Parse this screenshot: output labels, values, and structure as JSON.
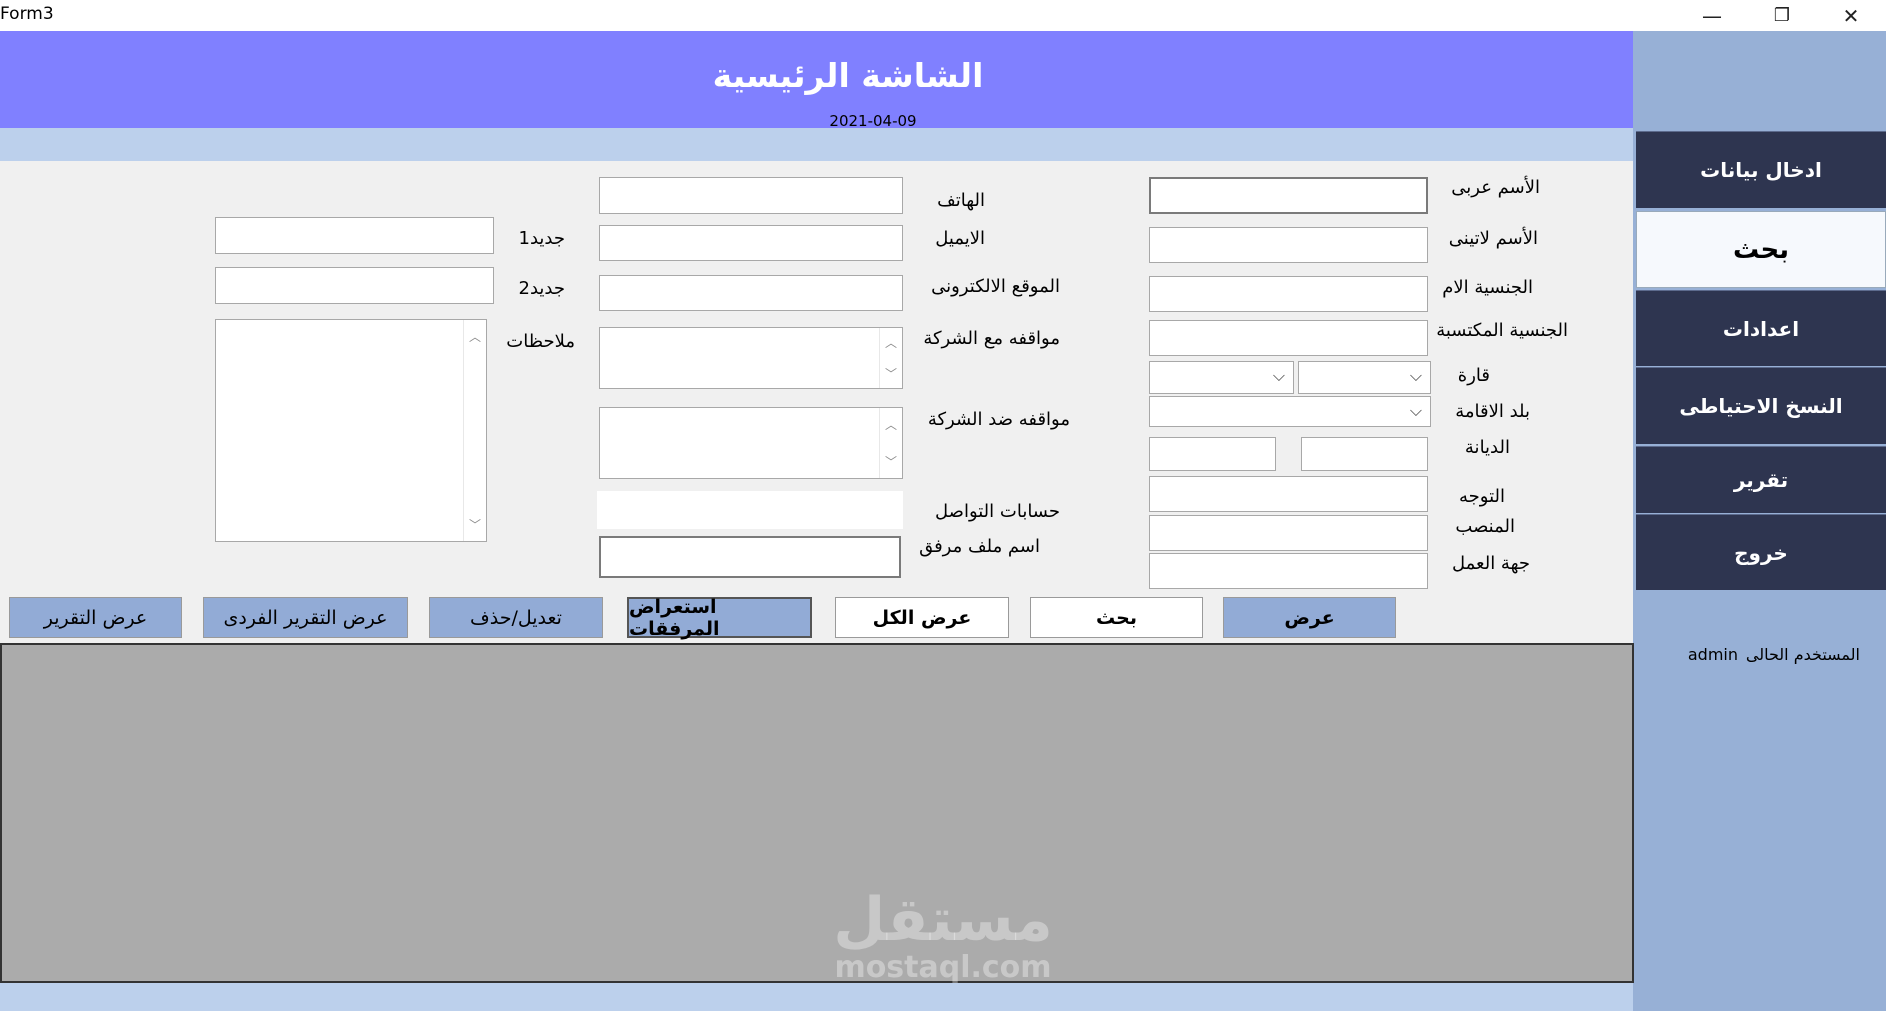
{
  "window": {
    "title": "Form3",
    "minimize": "—",
    "restore": "❐",
    "close": "✕"
  },
  "header": {
    "title": "الشاشة الرئيسية",
    "date": "2021-04-09"
  },
  "sidebar": {
    "items": [
      {
        "label": "ادخال بيانات"
      },
      {
        "label": "بحث"
      },
      {
        "label": "اعدادات"
      },
      {
        "label": "النسخ الاحتياطى"
      },
      {
        "label": "تقرير"
      },
      {
        "label": "خروج"
      }
    ],
    "active_index": 1,
    "current_user_label": "المستخدم الحالى",
    "current_user_value": "admin"
  },
  "form": {
    "labels": {
      "arabic_name": "الأسم عربى",
      "latin_name": "الأسم لاتينى",
      "mother_nationality": "الجنسية الام",
      "acquired_nationality": "الجنسية المكتسبة",
      "continent": "قارة",
      "residence_country": "بلد الاقامة",
      "religion": "الديانة",
      "orientation": "التوجه",
      "position": "المنصب",
      "employer": "جهة العمل",
      "phone": "الهاتف",
      "email": "الايميل",
      "website": "الموقع الالكترونى",
      "pro_company": "مواقفه مع الشركة",
      "against_company": "مواقفه ضد الشركة",
      "social_accounts": "حسابات التواصل",
      "attachment_name": "اسم ملف مرفق",
      "new1": "جديد1",
      "new2": "جديد2",
      "notes": "ملاحظات"
    },
    "values": {
      "arabic_name": "",
      "latin_name": "",
      "mother_nationality": "",
      "acquired_nationality": "",
      "continent": "",
      "residence_country": "",
      "religion_a": "",
      "religion_b": "",
      "orientation": "",
      "position": "",
      "employer": "",
      "phone": "",
      "email": "",
      "website": "",
      "social_accounts": "",
      "attachment_name": "",
      "new1": "",
      "new2": ""
    }
  },
  "buttons": {
    "show": "عرض",
    "search": "بحث",
    "show_all": "عرض الكل",
    "browse_attachments": "استعراض المرفقات",
    "edit_delete": "تعديل/حذف",
    "individual_report": "عرض التقرير الفردى",
    "report": "عرض التقرير"
  },
  "watermark": {
    "text": "مستقل",
    "domain": "mostaql.com"
  }
}
